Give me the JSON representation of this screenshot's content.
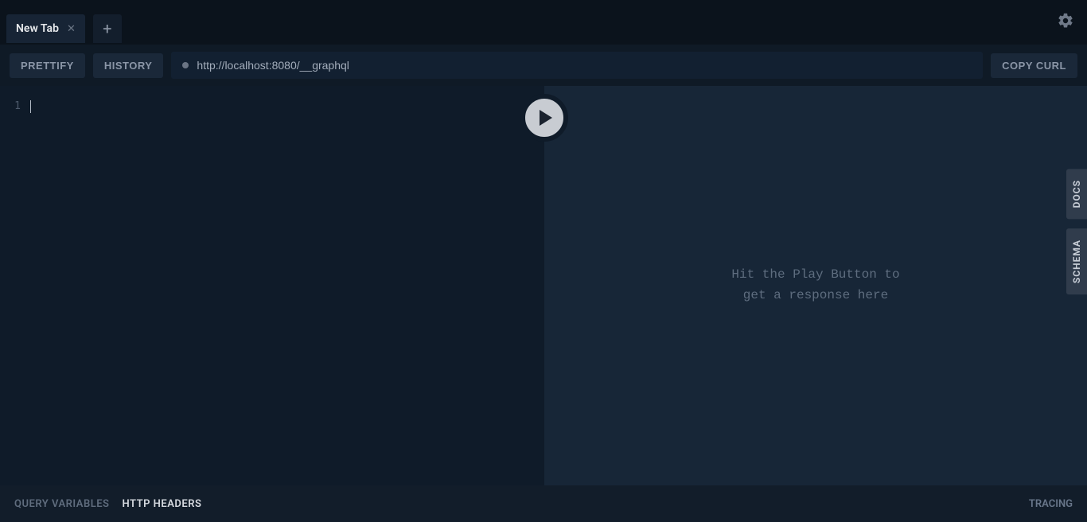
{
  "tabs": {
    "active_label": "New Tab"
  },
  "toolbar": {
    "prettify": "PRETTIFY",
    "history": "HISTORY",
    "copy_curl": "COPY CURL",
    "endpoint": "http://localhost:8080/__graphql"
  },
  "editor": {
    "line_number": "1"
  },
  "response": {
    "placeholder": "Hit the Play Button to\nget a response here"
  },
  "side": {
    "docs": "DOCS",
    "schema": "SCHEMA"
  },
  "footer": {
    "query_vars": "QUERY VARIABLES",
    "http_headers": "HTTP HEADERS",
    "tracing": "TRACING"
  }
}
